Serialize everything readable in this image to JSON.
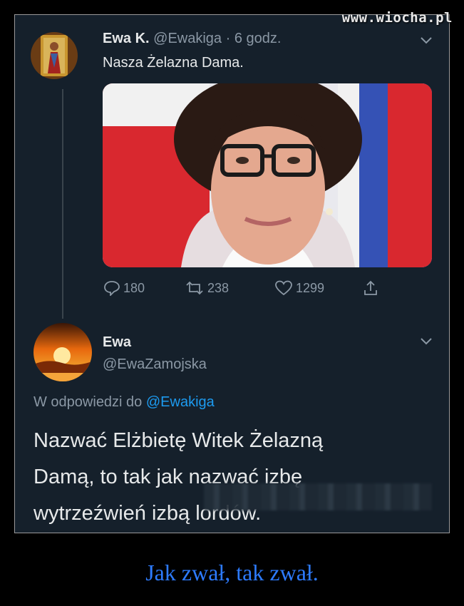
{
  "watermark": "www.wiocha.pl",
  "tweet": {
    "name": "Ewa K.",
    "handle": "@Ewakiga",
    "time": "· 6 godz.",
    "text": "Nasza Żelazna Dama.",
    "replies": "180",
    "retweets": "238",
    "likes": "1299"
  },
  "reply": {
    "name": "Ewa",
    "handle": "@EwaZamojska",
    "reply_prefix": "W odpowiedzi do",
    "reply_target": "@Ewakiga",
    "text_lines": [
      "Nazwać Elżbietę Witek Żelazną",
      "Damą, to tak jak nazwać izbę",
      "wytrzeźwień izbą lordów."
    ]
  },
  "caption": "Jak zwał, tak zwał.",
  "colors": {
    "background": "#15202b",
    "text": "#e7e9ea",
    "muted": "#8b98a5",
    "link": "#1d9bf0",
    "caption": "#2d7bff"
  },
  "icons": [
    "reply-icon",
    "retweet-icon",
    "like-icon",
    "share-icon",
    "chevron-down-icon"
  ]
}
